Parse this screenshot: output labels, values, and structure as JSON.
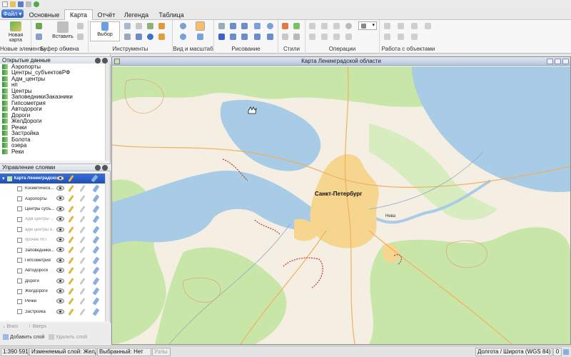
{
  "ribbon": {
    "file_button": "Файл",
    "tabs": [
      "Основные",
      "Карта",
      "Отчёт",
      "Легенда",
      "Таблица"
    ],
    "active_tab": "Карта",
    "new_map_label": "Новая карта",
    "insert_label": "Вставить",
    "select_label": "Выбор",
    "groups": [
      "Новые элементы",
      "Буфер обмена",
      "Инструменты",
      "Вид и масштаб",
      "Рисование",
      "Стили",
      "Операции",
      "Работа с объектами"
    ]
  },
  "open_data": {
    "title": "Открытые данные",
    "items": [
      "Аэропорты",
      "Центры_субъектовРФ",
      "Адм_центры",
      "нп",
      "Центры",
      "ЗаповедникиЗаказники",
      "Гипсометрия",
      "Автодороги",
      "Дороги",
      "ЖелДороги",
      "Речки",
      "Застройка",
      "Болота",
      "озера",
      "Реки"
    ]
  },
  "layer_manager": {
    "title": "Управление слоями",
    "root_label": "Карта Ленинградско...",
    "layers": [
      {
        "name": "Косметическ...",
        "dim": false
      },
      {
        "name": "Аэропорты",
        "dim": false
      },
      {
        "name": "Центры субъ...",
        "dim": false
      },
      {
        "name": "Адм центры ...",
        "dim": true
      },
      {
        "name": "адм центры о...",
        "dim": true
      },
      {
        "name": "прочие НП",
        "dim": true
      },
      {
        "name": "Заповедники...",
        "dim": false
      },
      {
        "name": "Гипсометрия",
        "dim": false
      },
      {
        "name": "Автодороги",
        "dim": false
      },
      {
        "name": "Дороги",
        "dim": false
      },
      {
        "name": "ЖелДороги",
        "dim": false
      },
      {
        "name": "Речки",
        "dim": false
      },
      {
        "name": "Застройка",
        "dim": false
      }
    ],
    "down_label": "Вниз",
    "up_label": "Вверх",
    "add_label": "Добавить слой",
    "remove_label": "Удалить слой"
  },
  "map": {
    "window_title": "Карта Ленинградской области",
    "city_label": "Санкт-Петербург",
    "river_label": "Нева"
  },
  "status": {
    "scale": "1:390 591",
    "changed_layer": "Изменяемый слой: ЖелДороги",
    "selected": "Выбранный: Нет",
    "nodes": "Узлы",
    "coord_system": "Долгота / Широта (WGS 84)",
    "count": "0"
  },
  "colors": {
    "water": "#a8cbe6",
    "land": "#f4efe2",
    "forest": "#c8e6a8",
    "urban": "#f6d58e",
    "accent": "#2d5fc4"
  }
}
